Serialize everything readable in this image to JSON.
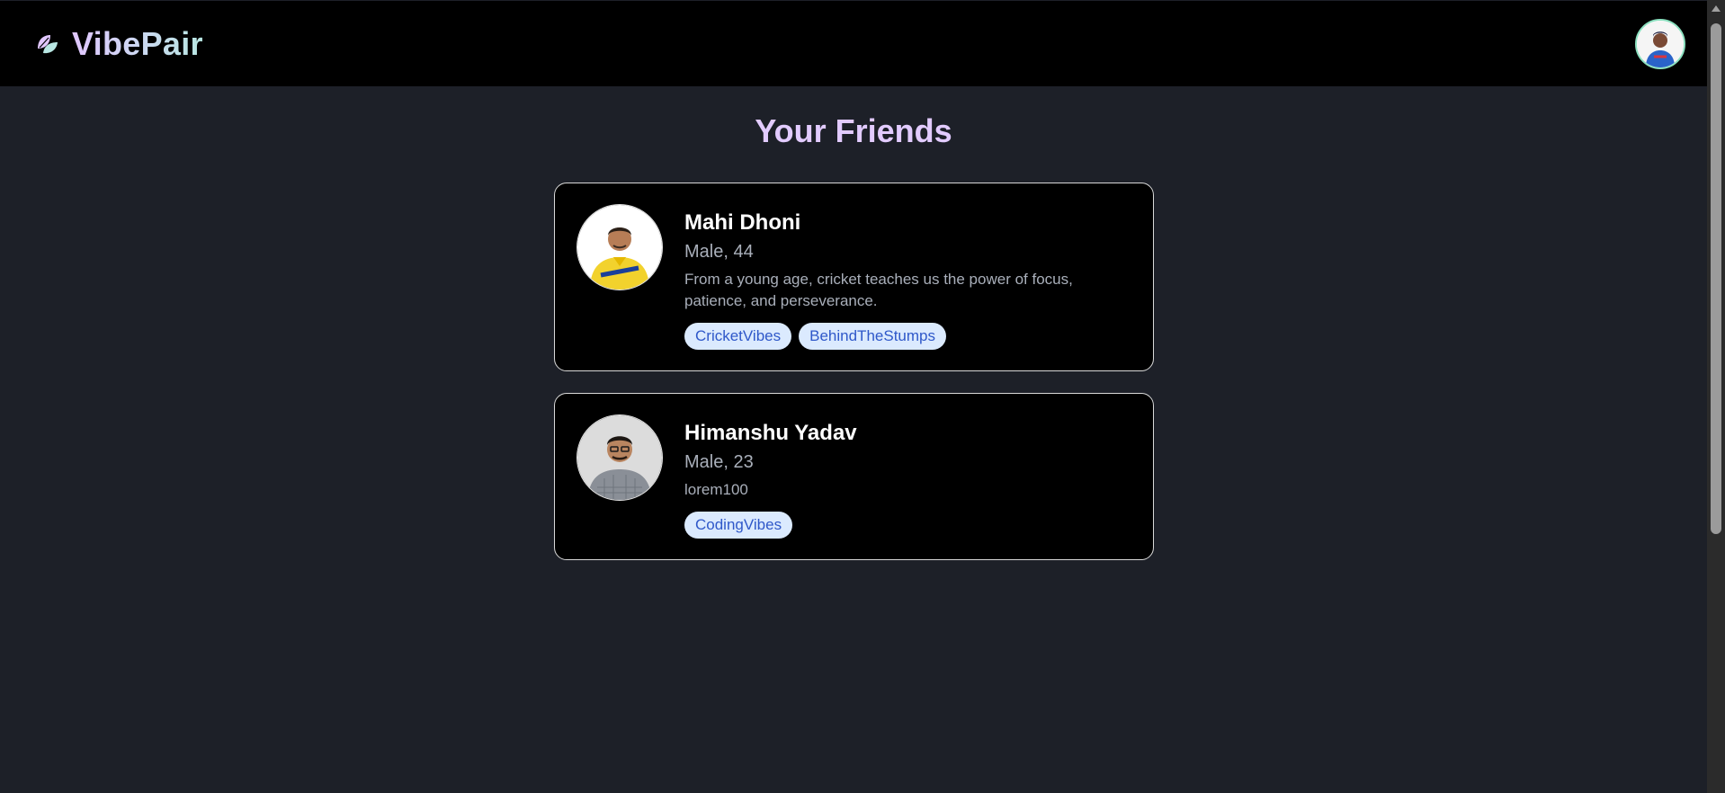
{
  "app": {
    "brand_name": "VibePair",
    "brand_gradient": [
      "#e1c7ff",
      "#b8e7e3"
    ],
    "icons": {
      "brand": "leaf-pair-icon",
      "profile": "user-avatar-icon"
    }
  },
  "main": {
    "title": "Your Friends",
    "friends": [
      {
        "name": "Mahi Dhoni",
        "meta": "Male, 44",
        "bio": "From a young age, cricket teaches us the power of focus, patience, and perseverance.",
        "tags": [
          "CricketVibes",
          "BehindTheStumps"
        ],
        "avatar_colors": {
          "shirt": "#f2d22d",
          "skin": "#b77d56"
        }
      },
      {
        "name": "Himanshu Yadav",
        "meta": "Male, 23",
        "bio": "lorem100",
        "tags": [
          "CodingVibes"
        ],
        "avatar_colors": {
          "shirt": "#8a8f97",
          "skin": "#b98560"
        }
      }
    ]
  },
  "colors": {
    "background": "#1d2028",
    "navbar": "#000000",
    "card": "#000000",
    "title": "#e2cbff",
    "tag_bg": "#dbeafe",
    "tag_text": "#2f58c9"
  }
}
